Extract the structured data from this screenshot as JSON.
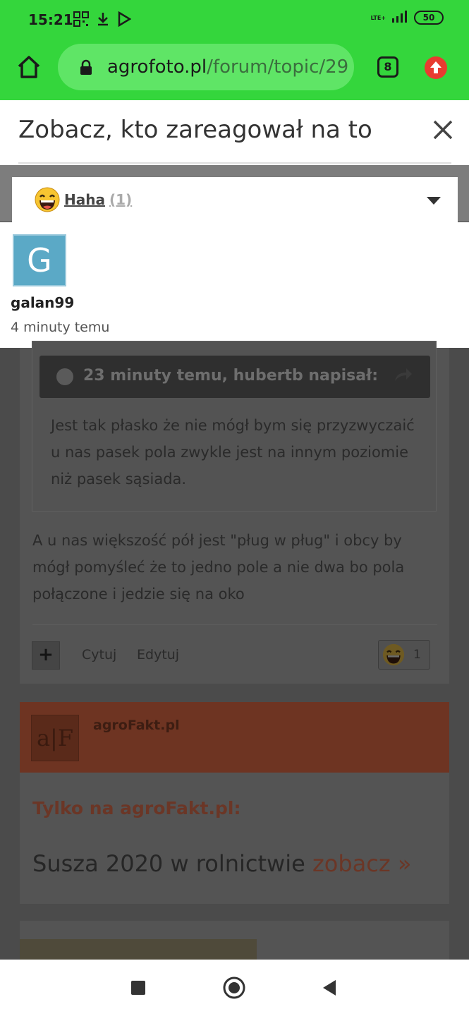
{
  "status_bar": {
    "time": "15:21",
    "network": "LTE+",
    "battery": "50"
  },
  "browser": {
    "url_domain": "agrofoto.pl",
    "url_path": "/forum/topic/29",
    "tab_count": "8",
    "icons": [
      "home-icon",
      "lock-icon",
      "tabs-icon",
      "update-icon"
    ]
  },
  "modal": {
    "title": "Zobacz, kto zareagował na to",
    "reaction_label": "Haha",
    "reaction_count": "(1)",
    "users": [
      {
        "initial": "G",
        "name": "galan99",
        "time": "4 minuty temu"
      }
    ]
  },
  "background": {
    "quote_header": "23 minuty temu, hubertb napisał:",
    "quote_body": "Jest tak płasko że nie mógł bym się przyzwyczaić u nas pasek pola zwykle jest na innym poziomie niż pasek sąsiada.",
    "post_body": "A u nas większość pół jest \"pług w pług\" i obcy by mógł pomyśleć że to jedno pole a nie dwa bo pola połączone i jedzie się na oko",
    "plus": "+",
    "quote_action": "Cytuj",
    "edit_action": "Edytuj",
    "reaction_badge_count": "1",
    "promo_logo": "a|F",
    "promo_site": "agroFakt.pl",
    "promo_tagline": "Tylko na agroFakt.pl:",
    "promo_text": "Susza 2020 w rolnictwie ",
    "promo_link": "zobacz »"
  },
  "colors": {
    "status_bar": "#34d63c",
    "url_box": "#5fe566",
    "avatar": "#5ba9c6",
    "update_badge": "#e83b30"
  }
}
